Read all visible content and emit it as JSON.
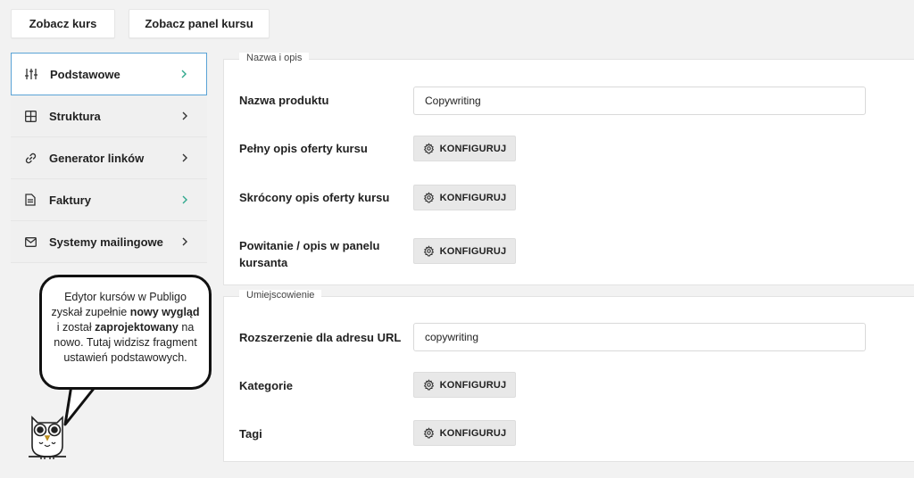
{
  "top_buttons": {
    "course": "Zobacz kurs",
    "panel": "Zobacz panel kursu"
  },
  "sidebar": {
    "items": [
      {
        "label": "Podstawowe",
        "icon": "sliders-icon",
        "active": true
      },
      {
        "label": "Struktura",
        "icon": "grid-icon"
      },
      {
        "label": "Generator linków",
        "icon": "link-icon"
      },
      {
        "label": "Faktury",
        "icon": "document-icon"
      },
      {
        "label": "Systemy mailingowe",
        "icon": "mail-icon"
      }
    ]
  },
  "section1": {
    "legend": "Nazwa i opis",
    "product_name_label": "Nazwa produktu",
    "product_name_value": "Copywriting",
    "full_desc_label": "Pełny opis oferty kursu",
    "short_desc_label": "Skrócony opis oferty kursu",
    "welcome_label_line1": "Powitanie / opis w panelu",
    "welcome_label_line2": "kursanta"
  },
  "section2": {
    "legend": "Umiejscowienie",
    "url_label": "Rozszerzenie dla adresu URL",
    "url_value": "copywriting",
    "categories_label": "Kategorie",
    "tags_label": "Tagi"
  },
  "configure_label": "KONFIGURUJ",
  "bubble": {
    "t1": "Edytor kursów w Publigo zyskał zupełnie ",
    "b1": "nowy wygląd",
    "t2": " i został ",
    "b2": "zaprojektowany",
    "t3": " na nowo. Tutaj widzisz fragment ustawień podstawowych."
  },
  "colors": {
    "accent_chevron": "#2fa88c",
    "active_border": "#5aa3d6"
  }
}
